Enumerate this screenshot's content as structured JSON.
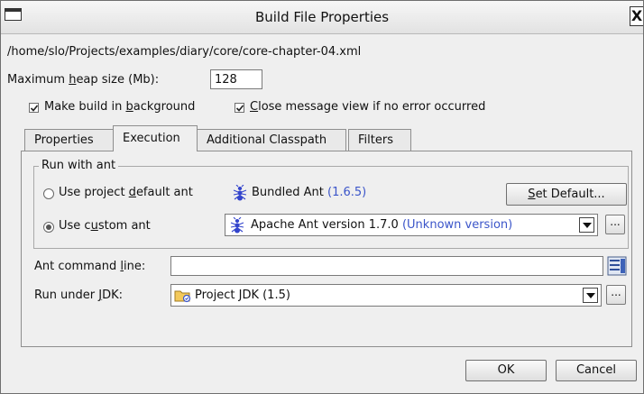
{
  "window": {
    "title": "Build File Properties",
    "close_label": "X"
  },
  "file_path": "/home/slo/Projects/examples/diary/core/core-chapter-04.xml",
  "heap": {
    "label_pre": "Maximum ",
    "label_mnemonic": "h",
    "label_post": "eap size (Mb):",
    "value": "128"
  },
  "options": {
    "background": {
      "pre": "Make build in ",
      "mnemonic": "b",
      "post": "ackground",
      "checked": true
    },
    "close_message": {
      "pre": "",
      "mnemonic": "C",
      "post": "lose message view if no error occurred",
      "checked": true
    }
  },
  "tabs": [
    {
      "label": "Properties",
      "active": false
    },
    {
      "label": "Execution",
      "active": true
    },
    {
      "label": "Additional Classpath",
      "active": false
    },
    {
      "label": "Filters",
      "active": false
    }
  ],
  "run_with_ant": {
    "legend": "Run with ant",
    "default_option": {
      "pre": "Use project ",
      "mnemonic": "d",
      "post": "efault ant",
      "selected": false,
      "ant_name": "Bundled Ant",
      "ant_version": "(1.6.5)",
      "button_mnemonic": "S",
      "button_post": "et Default..."
    },
    "custom_option": {
      "pre": "Use c",
      "mnemonic": "u",
      "post": "stom ant",
      "selected": true,
      "selected_ant": "Apache Ant version 1.7.0",
      "selected_ant_note": "(Unknown version)",
      "browse": "..."
    }
  },
  "command_line": {
    "label_pre": "Ant command ",
    "label_mnemonic": "l",
    "label_post": "ine:",
    "value": ""
  },
  "jdk": {
    "label_pre": "Run under ",
    "label_mnemonic": "J",
    "label_post": "DK:",
    "value": "Project JDK (1.5)",
    "browse": "..."
  },
  "footer": {
    "ok": "OK",
    "cancel": "Cancel"
  },
  "icons": {
    "ant": "ant-icon",
    "jdk": "jdk-folder-icon",
    "cmd_editor": "expand-editor-icon"
  },
  "colors": {
    "accent_text": "#3b55c9",
    "ant_icon": "#3344cc"
  }
}
